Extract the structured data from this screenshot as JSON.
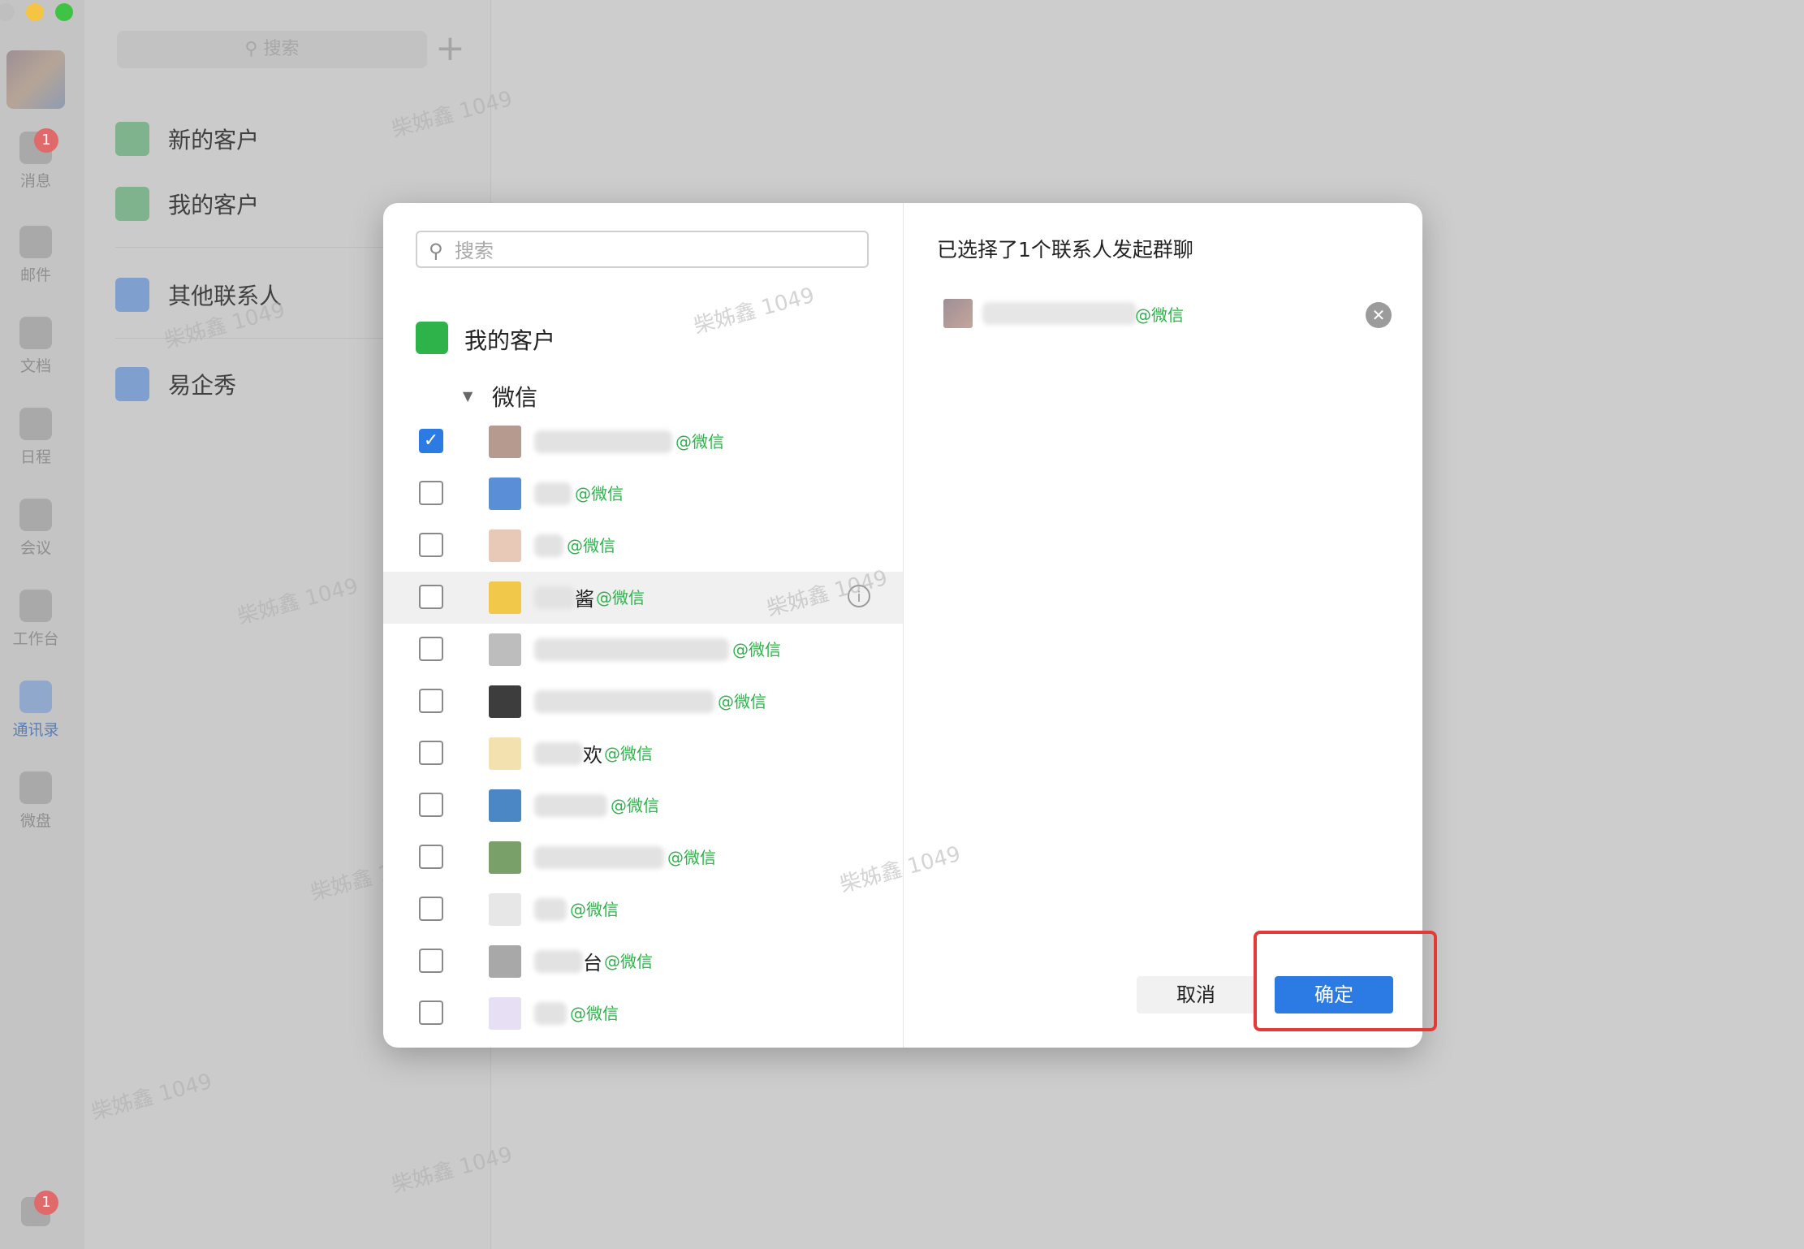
{
  "rail": {
    "items": [
      {
        "label": "消息",
        "badge": "1"
      },
      {
        "label": "邮件"
      },
      {
        "label": "文档"
      },
      {
        "label": "日程"
      },
      {
        "label": "会议"
      },
      {
        "label": "工作台"
      },
      {
        "label": "通讯录",
        "active": true
      },
      {
        "label": "微盘"
      }
    ],
    "bottom_badge": "1"
  },
  "col2": {
    "search_placeholder": "搜索",
    "add_icon": "+",
    "nav": [
      {
        "label": "新的客户",
        "icon": "add-contact-icon",
        "color": "#7fb38e"
      },
      {
        "label": "我的客户",
        "icon": "wechat-icon",
        "color": "#7fb38e"
      },
      {
        "label": "其他联系人",
        "icon": "apps-icon",
        "color": "#7f9fcf"
      },
      {
        "label": "易企秀",
        "icon": "folder-icon",
        "color": "#7f9fcf"
      }
    ]
  },
  "watermark": "柴姊鑫 1049",
  "modal": {
    "search_placeholder": "搜索",
    "group_title": "我的客户",
    "subgroup": "微信",
    "tag": "@微信",
    "selected_title": "已选择了1个联系人发起群聊",
    "cancel_label": "取消",
    "confirm_label": "确定",
    "contacts": [
      {
        "checked": true,
        "avatar": "#b79a8f",
        "name_w": 170,
        "trail": ""
      },
      {
        "checked": false,
        "avatar": "#5a8fd8",
        "name_w": 46,
        "trail": ""
      },
      {
        "checked": false,
        "avatar": "#e8c9b7",
        "name_w": 36,
        "trail": ""
      },
      {
        "checked": false,
        "avatar": "#f2c84b",
        "name_w": 50,
        "trail": "酱",
        "hover": true
      },
      {
        "checked": false,
        "avatar": "#bdbdbd",
        "name_w": 240,
        "trail": ""
      },
      {
        "checked": false,
        "avatar": "#3d3d3d",
        "name_w": 222,
        "trail": ""
      },
      {
        "checked": false,
        "avatar": "#f3e1b0",
        "name_w": 60,
        "trail": "欢"
      },
      {
        "checked": false,
        "avatar": "#4b86c5",
        "name_w": 90,
        "trail": ""
      },
      {
        "checked": false,
        "avatar": "#7aa06a",
        "name_w": 160,
        "trail": ""
      },
      {
        "checked": false,
        "avatar": "#e7e7e7",
        "name_w": 40,
        "trail": ""
      },
      {
        "checked": false,
        "avatar": "#a8a8a8",
        "name_w": 60,
        "trail": "台"
      },
      {
        "checked": false,
        "avatar": "#e7e0f4",
        "name_w": 40,
        "trail": ""
      }
    ],
    "selected": [
      {
        "avatar": "#b79a8f",
        "name_w": 190
      }
    ],
    "colors": {
      "accent": "#2c7be5",
      "wechat_green": "#2db34a",
      "highlight_box": "#e53935"
    }
  }
}
